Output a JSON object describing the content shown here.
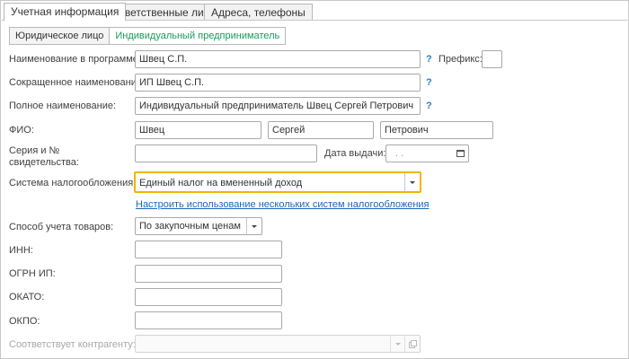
{
  "tabs": [
    {
      "label": "Учетная информация",
      "active": true
    },
    {
      "label": "Ответственные лица",
      "active": false
    },
    {
      "label": "Адреса, телефоны",
      "active": false
    }
  ],
  "entity_type": {
    "options": [
      "Юридическое лицо",
      "Индивидуальный предприниматель"
    ],
    "selected": "Индивидуальный предприниматель"
  },
  "form": {
    "name_in_program": {
      "label": "Наименование в программе:",
      "value": "Швец С.П."
    },
    "prefix": {
      "label": "Префикс:",
      "value": ""
    },
    "short_name": {
      "label": "Сокращенное наименование:",
      "value": "ИП Швец С.П."
    },
    "full_name": {
      "label": "Полное наименование:",
      "value": "Индивидуальный предприниматель Швец Сергей Петрович"
    },
    "fio": {
      "label": "ФИО:",
      "last": "Швец",
      "first": "Сергей",
      "middle": "Петрович"
    },
    "cert_series": {
      "label_line1": "Серия и №",
      "label_line2": "свидетельства:",
      "value": ""
    },
    "issue_date": {
      "label": "Дата выдачи:",
      "value": ". ."
    },
    "tax_system": {
      "label": "Система налогообложения:",
      "value": "Единый налог на вмененный доход"
    },
    "tax_link": "Настроить использование нескольких систем налогообложения",
    "goods_accounting": {
      "label": "Способ учета товаров:",
      "value": "По закупочным ценам"
    },
    "inn": {
      "label": "ИНН:",
      "value": ""
    },
    "ogrn": {
      "label": "ОГРН ИП:",
      "value": ""
    },
    "okato": {
      "label": "ОКАТО:",
      "value": ""
    },
    "okpo": {
      "label": "ОКПО:",
      "value": ""
    },
    "counterparty": {
      "label": "Соответствует контрагенту:",
      "value": ""
    }
  },
  "help_mark": "?",
  "colors": {
    "accent_green": "#1a9a5a",
    "focus_border": "#f2b400",
    "link_blue": "#1d64b8",
    "help_blue": "#2a7fc4"
  }
}
